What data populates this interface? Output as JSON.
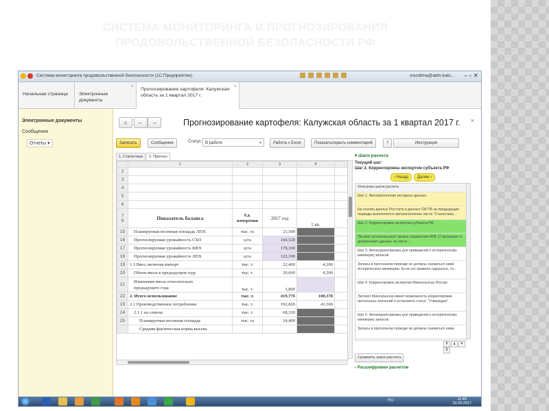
{
  "slide": {
    "title_line1": "СИСТЕМА МОНИТОРИНГА И ПРОГНОЗИРОВАНИЯ",
    "title_line2": "ПРОДОВОЛЬСТВЕННОЙ БЕЗОПАСНОСТИ РФ"
  },
  "window": {
    "title": "Система мониторинга продовольственной безопасности (1С:Предприятие)",
    "user": "sourdima@adm.kalu…"
  },
  "tabs": [
    {
      "label": "Начальная страница"
    },
    {
      "label": "Электронные документы"
    },
    {
      "label": "Прогнозирование картофеля: Калужская область за 1 квартал 2017 г."
    }
  ],
  "sidebar": {
    "heading": "Электронные документы",
    "item1": "Сообщения",
    "item2": "Отчеты"
  },
  "document": {
    "title": "Прогнозирование картофеля: Калужская область за 1 квартал 2017 г.",
    "save_label": "Записать",
    "messages_label": "Сообщения",
    "status_label": "Статус:",
    "status_value": "В работе",
    "excel_label": "Работа с Excel",
    "comments_label": "Показать/скрыть комментарий",
    "help_label": "?",
    "instruction_label": "Инструкция",
    "subtab1": "1. Статистика",
    "subtab2": "2. Прогноз"
  },
  "sheet": {
    "col_headers": [
      "1",
      "2",
      "3",
      "4"
    ],
    "blank_rows": [
      "2",
      "3",
      "4",
      "5",
      "6"
    ],
    "header_row_nums": [
      "7",
      "8"
    ],
    "header": {
      "indicator": "Показатель баланса",
      "unit": "Ед. измерения",
      "year": "2017 год",
      "q1": "1 кв."
    },
    "rows": [
      {
        "n": "15",
        "name": "Планируемая посевная площадь ЛПХ",
        "unit": "тыс. га",
        "year": "21,500",
        "q1": ""
      },
      {
        "n": "16",
        "name": "Прогнозируемая урожайность СХО",
        "unit": "ц/га",
        "year": "160,520",
        "q1": ""
      },
      {
        "n": "17",
        "name": "Прогнозируемая урожайность КФХ",
        "unit": "ц/га",
        "year": "178,100",
        "q1": ""
      },
      {
        "n": "18",
        "name": "Прогнозируемая урожайность ЛПХ",
        "unit": "ц/га",
        "year": "122,100",
        "q1": ""
      },
      {
        "n": "19",
        "name": "1.3 Ввоз, включая импорт",
        "unit": "тыс. т.",
        "year": "22,400",
        "q1": "4,200"
      },
      {
        "n": "20",
        "name": "Объем ввоза в предыдущем году",
        "unit": "тыс. т.",
        "year": "20,600",
        "q1": "4,200"
      },
      {
        "n": "21",
        "name_l1": "Изменение ввоза относительно",
        "name_l2": "предыдущего года",
        "unit": "тыс. т.",
        "year": "1,800",
        "q1": ""
      },
      {
        "n": "22",
        "name": "2. Итого использование",
        "unit": "тыс. т.",
        "year": "419,776",
        "q1": "100,378"
      },
      {
        "n": "23",
        "name": "2.1 Производственное потребление",
        "unit": "тыс. т.",
        "year": "192,820",
        "q1": "41,500"
      },
      {
        "n": "24",
        "name": "2.1.1 на семена",
        "unit": "тыс. т.",
        "year": "68,320",
        "q1": ""
      },
      {
        "n": "25",
        "name": "Планируемая посевная площадь",
        "unit": "тыс. га",
        "year": "24,400",
        "q1": ""
      },
      {
        "n": "",
        "name": "Средняя фактическая норма высева",
        "unit": "",
        "year": "",
        "q1": ""
      }
    ]
  },
  "steps": {
    "heading": "Шаги расчета",
    "current_label": "Текущий шаг:",
    "current_step": "Шаг 2. Корректировка экспертом субъекта РФ",
    "back_label": "Назад",
    "next_label": "Далее",
    "items": [
      "Описание шагов расчета",
      "Шаг 1. Автозаполнение исходных данных",
      "На основе данных Росстата и данных СМ ПБ за предыдущие периоды выполняется автозаполнение листа \"Статистика…",
      "Шаг 2. Корректировка экспертом субъекта РФ",
      "Эксперт регионального органа управления АПК 1) проверяет и дозаполняет данные на листе…",
      "Шаг 3. Автокорректировка для приведения к историческому минимуму запасов",
      "Запасы в прогнозном периоде не должны снижаться ниже исторического минимума. Если это правило нарушено, то…",
      "Шаг 4. Корректировка экспертом Минсельхоза России",
      "Эксперт Минсельхоза имеет возможность корректировки прогнозных значений и установить статус \"Утвержден\"",
      "Шаг 5. Автокорректировка для приведения к историческому минимуму запасов",
      "Запасы в прогнозном периоде не должны снижаться ниже"
    ],
    "compare_label": "Сравнить шаги расчета",
    "decode_label": "Расшифровки расчетов"
  },
  "taskbar": {
    "lang": "RU",
    "time": "11:40",
    "date": "20.04.2017"
  }
}
